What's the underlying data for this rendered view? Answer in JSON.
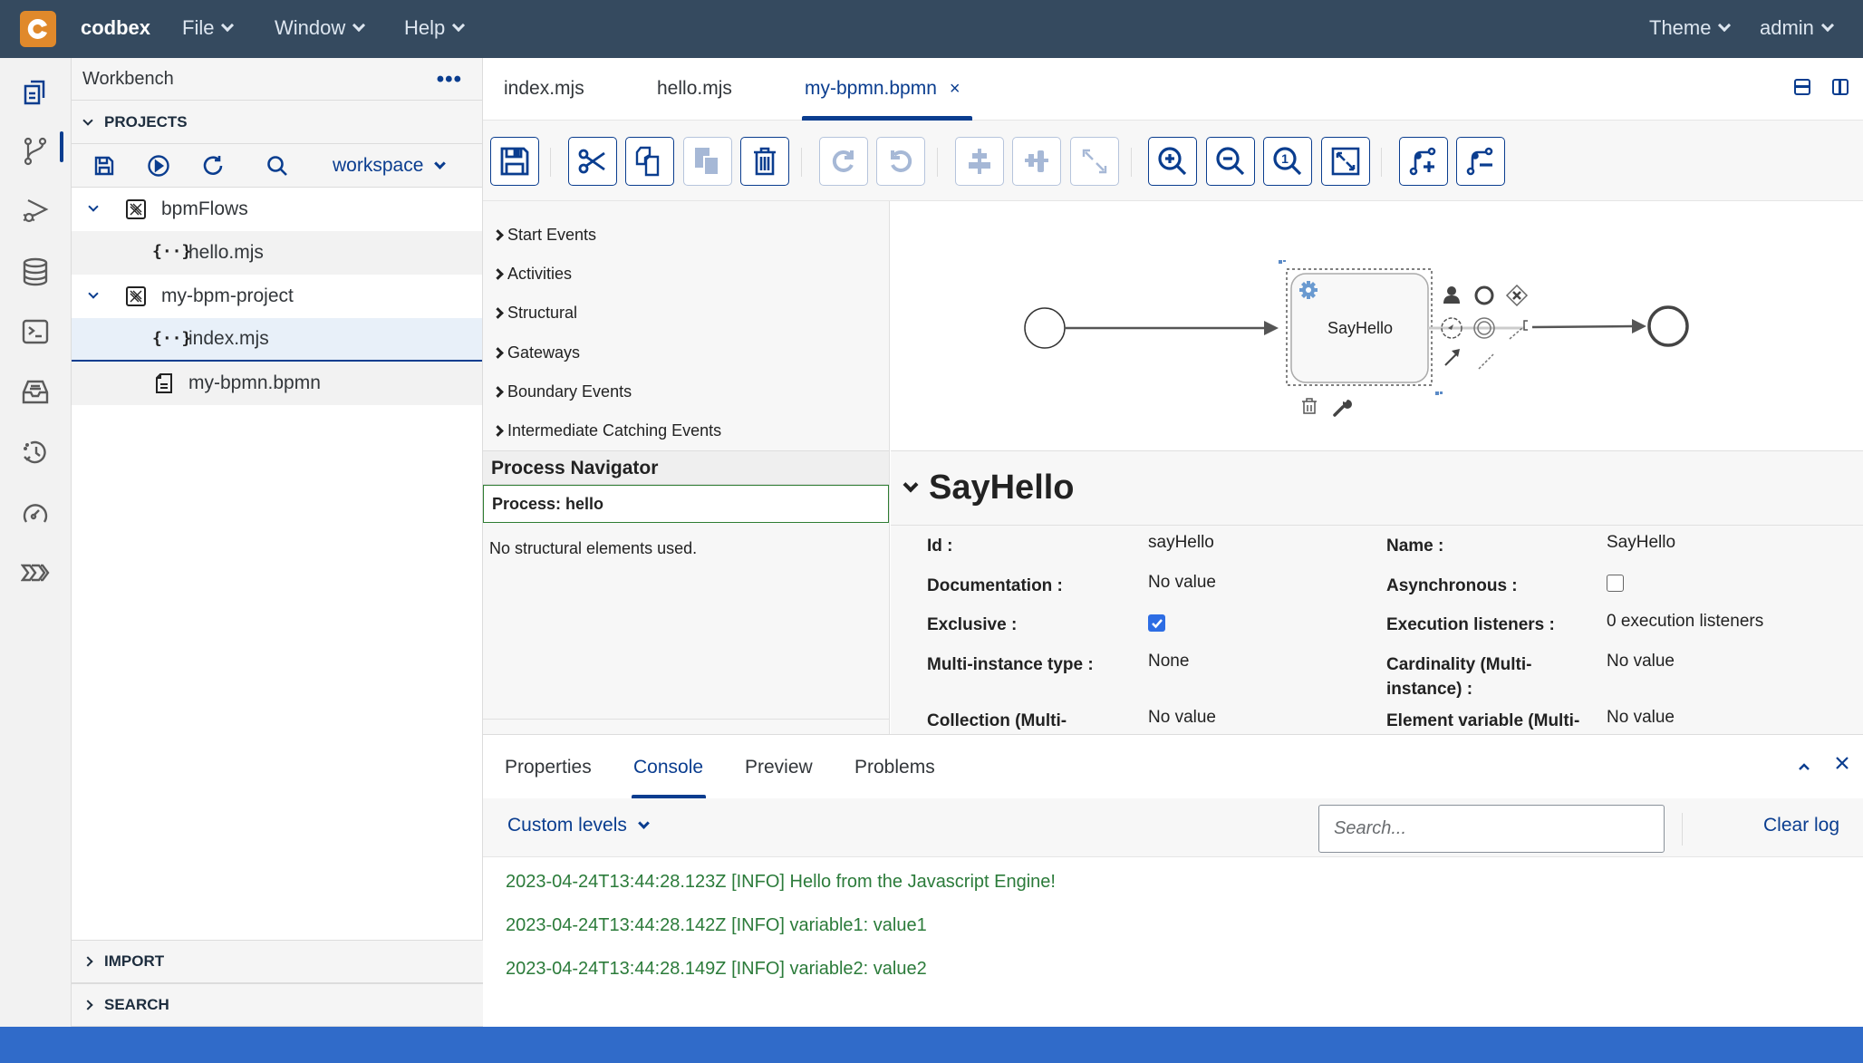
{
  "app": {
    "brand": "codbex",
    "menus": [
      "File",
      "Window",
      "Help"
    ],
    "right_menus": [
      "Theme",
      "admin"
    ]
  },
  "activity_bar": {
    "items": [
      "workbench-icon",
      "git-icon",
      "debug-icon",
      "database-icon",
      "terminal-icon",
      "inbox-icon",
      "history-icon",
      "dashboard-icon",
      "flows-icon"
    ],
    "active": "workbench-icon"
  },
  "sidebar": {
    "title": "Workbench",
    "more_label": "•••",
    "projects_label": "PROJECTS",
    "workspace": "workspace",
    "tree": [
      {
        "label": "bpmFlows",
        "type": "project",
        "expanded": true
      },
      {
        "label": "hello.mjs",
        "type": "file-js"
      },
      {
        "label": "my-bpm-project",
        "type": "project",
        "expanded": true
      },
      {
        "label": "index.mjs",
        "type": "file-js",
        "selected": true
      },
      {
        "label": "my-bpmn.bpmn",
        "type": "file-doc"
      }
    ],
    "import_label": "IMPORT",
    "search_label": "SEARCH"
  },
  "editor_tabs": [
    {
      "label": "index.mjs"
    },
    {
      "label": "hello.mjs"
    },
    {
      "label": "my-bpmn.bpmn",
      "active": true,
      "close": "×"
    }
  ],
  "toolbar": {
    "buttons": [
      {
        "name": "save",
        "enabled": true
      },
      {
        "name": "cut",
        "enabled": true
      },
      {
        "name": "copy",
        "enabled": true
      },
      {
        "name": "paste",
        "enabled": false
      },
      {
        "name": "delete",
        "enabled": true
      },
      {
        "name": "redo",
        "enabled": false
      },
      {
        "name": "undo",
        "enabled": false
      },
      {
        "name": "align-horizontal",
        "enabled": false
      },
      {
        "name": "align-vertical",
        "enabled": false
      },
      {
        "name": "same-size",
        "enabled": false
      },
      {
        "name": "zoom-in",
        "enabled": true
      },
      {
        "name": "zoom-out",
        "enabled": true
      },
      {
        "name": "zoom-actual",
        "enabled": true
      },
      {
        "name": "zoom-fit",
        "enabled": true
      },
      {
        "name": "add-bendpoint",
        "enabled": true
      },
      {
        "name": "remove-bendpoint",
        "enabled": true
      }
    ]
  },
  "palette": {
    "groups": [
      "Start Events",
      "Activities",
      "Structural",
      "Gateways",
      "Boundary Events",
      "Intermediate Catching Events"
    ]
  },
  "navigator": {
    "title": "Process Navigator",
    "process": "Process: hello",
    "empty": "No structural elements used."
  },
  "diagram": {
    "task_label": "SayHello"
  },
  "properties": {
    "title": "SayHello",
    "left": [
      {
        "label": "Id :",
        "value": "sayHello"
      },
      {
        "label": "Documentation :",
        "value": "No value"
      },
      {
        "label": "Exclusive :",
        "checkbox": true
      },
      {
        "label": "Multi-instance type :",
        "value": "None"
      },
      {
        "label": "Collection (Multi-",
        "value": "No value"
      }
    ],
    "right": [
      {
        "label": "Name :",
        "value": "SayHello"
      },
      {
        "label": "Asynchronous :",
        "checkbox": false
      },
      {
        "label": "Execution listeners :",
        "value": "0 execution listeners"
      },
      {
        "label": "Cardinality (Multi-",
        "label2": "instance) :",
        "value": "No value"
      },
      {
        "label": "Element variable (Multi-",
        "value": "No value"
      }
    ]
  },
  "bottom_panel": {
    "tabs": [
      "Properties",
      "Console",
      "Preview",
      "Problems"
    ],
    "active_tab": "Console",
    "levels_label": "Custom levels",
    "search_placeholder": "Search...",
    "clear_label": "Clear log",
    "logs": [
      "2023-04-24T13:44:28.123Z [INFO] Hello from the Javascript Engine!",
      "2023-04-24T13:44:28.142Z [INFO] variable1: value1",
      "2023-04-24T13:44:28.149Z [INFO] variable2: value2"
    ]
  },
  "colors": {
    "topbar": "#354a5f",
    "accent": "#0a3d8f",
    "logo": "#e0892b",
    "statusbar": "#306bc9",
    "log_info": "#2b7b3a"
  }
}
